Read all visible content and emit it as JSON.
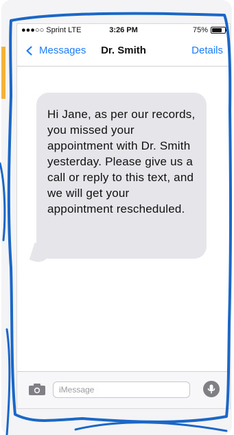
{
  "status_bar": {
    "carrier": "●●●○○ Sprint  LTE",
    "time": "3:26 PM",
    "battery_percent": "75%",
    "battery_icon": "battery-icon"
  },
  "nav": {
    "back_label": "Messages",
    "title": "Dr. Smith",
    "details_label": "Details",
    "back_icon": "chevron-left-icon",
    "accent_color": "#1b7cff"
  },
  "chat": {
    "messages": [
      {
        "text": "Hi Jane, as per our records, you missed your appointment with Dr. Smith yesterday. Please give us a call or reply to this text, and we will get your appointment rescheduled."
      }
    ],
    "bubble_color": "#e5e5ea"
  },
  "composer": {
    "placeholder": "iMessage",
    "camera_icon": "camera-icon",
    "mic_icon": "microphone-icon"
  },
  "overlay": {
    "outline_color": "#1a67c7",
    "left_accent_color": "#f2b33a"
  }
}
